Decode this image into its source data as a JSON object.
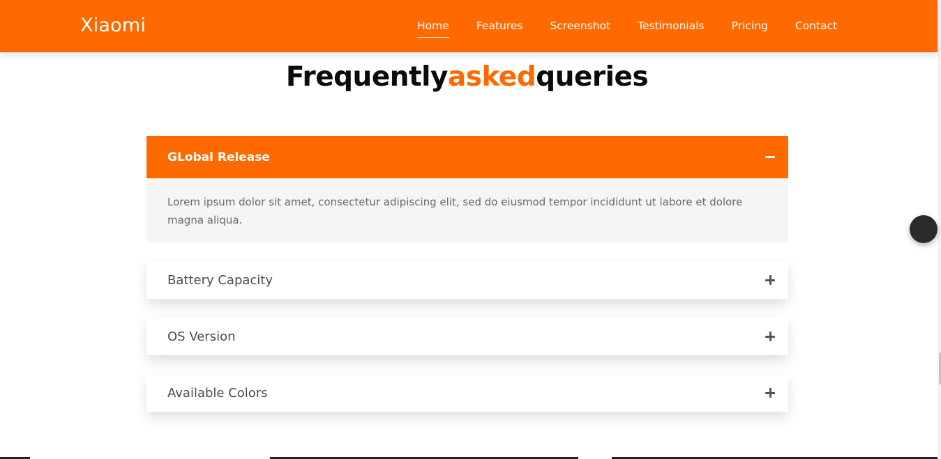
{
  "header": {
    "brand": "Xiaomi",
    "nav": [
      {
        "label": "Home",
        "active": true
      },
      {
        "label": "Features",
        "active": false
      },
      {
        "label": "Screenshot",
        "active": false
      },
      {
        "label": "Testimonials",
        "active": false
      },
      {
        "label": "Pricing",
        "active": false
      },
      {
        "label": "Contact",
        "active": false
      }
    ]
  },
  "faq_section": {
    "title_part1": "Frequently",
    "title_accent": "asked",
    "title_part2": "queries",
    "items": [
      {
        "question": "GLobal Release",
        "expanded": true,
        "icon": "minus-icon",
        "answer": "Lorem ipsum dolor sit amet, consectetur adipiscing elit, sed do eiusmod tempor incididunt ut labore et dolore magna aliqua."
      },
      {
        "question": "Battery Capacity",
        "expanded": false,
        "icon": "plus-icon"
      },
      {
        "question": "OS Version",
        "expanded": false,
        "icon": "plus-icon"
      },
      {
        "question": "Available Colors",
        "expanded": false,
        "icon": "plus-icon"
      }
    ]
  },
  "colors": {
    "accent": "#ff6a00",
    "text_dark": "#0b0b0b",
    "answer_bg": "#f5f5f5"
  }
}
